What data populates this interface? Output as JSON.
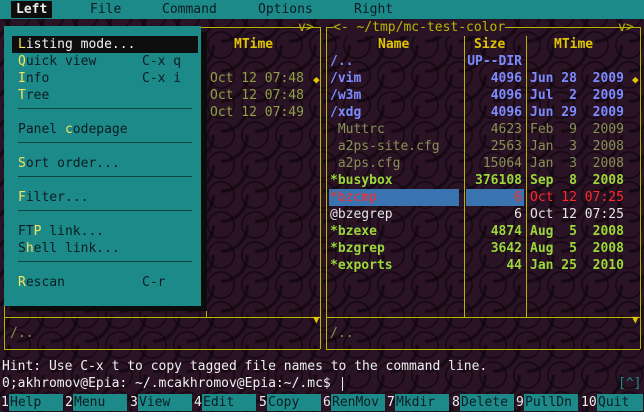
{
  "menubar": {
    "items": [
      "Left",
      "File",
      "Command",
      "Options",
      "Right"
    ],
    "active": "Left"
  },
  "left_panel": {
    "column_header": "MTime",
    "frame_right": "v>",
    "times": [
      "Oct 12 07:48",
      "Oct 12 07:48",
      "Oct 12 07:49"
    ],
    "mini_status": "/.."
  },
  "right_panel": {
    "title": "<- ~/tmp/mc-test-color",
    "frame_right": "v>",
    "headers": {
      "name": "Name",
      "size": "Size",
      "mtime": "MTime"
    },
    "rows": [
      {
        "name": "/..",
        "size": "UP--DIR",
        "mtime": "",
        "kind": "updir"
      },
      {
        "name": "/vim",
        "size": "4096",
        "mtime": "Jun 28  2009",
        "kind": "dir"
      },
      {
        "name": "/w3m",
        "size": "4096",
        "mtime": "Jul  2  2009",
        "kind": "dir"
      },
      {
        "name": "/xdg",
        "size": "4096",
        "mtime": "Jun 29  2009",
        "kind": "dir"
      },
      {
        "name": " Muttrc",
        "size": "4623",
        "mtime": "Feb  9  2009",
        "kind": "dim"
      },
      {
        "name": " a2ps-site.cfg",
        "size": "2563",
        "mtime": "Jan  3  2008",
        "kind": "dim"
      },
      {
        "name": " a2ps.cfg",
        "size": "15064",
        "mtime": "Jan  3  2008",
        "kind": "dim"
      },
      {
        "name": "*busybox",
        "size": "376108",
        "mtime": "Sep  8  2008",
        "kind": "exec"
      },
      {
        "name": "*bzcmp",
        "size": "6",
        "mtime": "Oct 12 07:25",
        "kind": "selected"
      },
      {
        "name": "@bzegrep",
        "size": "6",
        "mtime": "Oct 12 07:25",
        "kind": "link"
      },
      {
        "name": "*bzexe",
        "size": "4874",
        "mtime": "Aug  5  2008",
        "kind": "exec"
      },
      {
        "name": "*bzgrep",
        "size": "3642",
        "mtime": "Aug  5  2008",
        "kind": "exec"
      },
      {
        "name": "*exports",
        "size": "44",
        "mtime": "Jan 25  2010",
        "kind": "exec"
      }
    ],
    "mini_status": "/.."
  },
  "dropdown": {
    "items": [
      {
        "pre": "",
        "hot": "L",
        "post": "isting mode...",
        "key": "",
        "selected": true
      },
      {
        "pre": "",
        "hot": "Q",
        "post": "uick view",
        "key": "C-x q"
      },
      {
        "pre": "",
        "hot": "I",
        "post": "nfo",
        "key": "C-x i"
      },
      {
        "pre": "",
        "hot": "T",
        "post": "ree",
        "key": ""
      },
      {
        "pre": "Panel ",
        "hot": "c",
        "post": "odepage",
        "key": ""
      },
      {
        "pre": "",
        "hot": "S",
        "post": "ort order...",
        "key": ""
      },
      {
        "pre": "",
        "hot": "F",
        "post": "ilter...",
        "key": ""
      },
      {
        "pre": "FT",
        "hot": "P",
        "post": " link...",
        "key": ""
      },
      {
        "pre": "S",
        "hot": "h",
        "post": "ell link...",
        "key": ""
      },
      {
        "pre": "",
        "hot": "R",
        "post": "escan",
        "key": "C-r"
      }
    ]
  },
  "hint": "Hint: Use C-x t to copy tagged file names to the command line.",
  "command_line": "0;akhromov@Epia: ~/.mcakhromov@Epia:~/.mc$",
  "command_history_indicator": "[^]",
  "fkeys": [
    {
      "num": "1",
      "label": "Help"
    },
    {
      "num": "2",
      "label": "Menu"
    },
    {
      "num": "3",
      "label": "View"
    },
    {
      "num": "4",
      "label": "Edit"
    },
    {
      "num": "5",
      "label": "Copy"
    },
    {
      "num": "6",
      "label": "RenMov"
    },
    {
      "num": "7",
      "label": "Mkdir"
    },
    {
      "num": "8",
      "label": "Delete"
    },
    {
      "num": "9",
      "label": "PullDn"
    },
    {
      "num": "10",
      "label": "Quit"
    }
  ],
  "colors": {
    "menubar_bg": "#1d8a8a",
    "frame": "#b9b600",
    "header": "#e0c600",
    "directory": "#7c8cff",
    "executable": "#9cd83a",
    "selection_bar": "#3a74b0",
    "selected_text": "#ff2a2a"
  }
}
